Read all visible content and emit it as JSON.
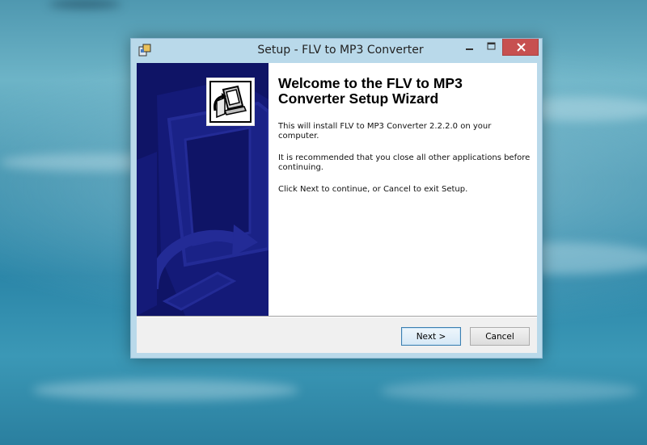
{
  "window": {
    "title": "Setup - FLV to MP3 Converter",
    "caption_buttons": [
      "minimize",
      "maximize",
      "close"
    ]
  },
  "wizard": {
    "heading": "Welcome to the FLV to MP3 Converter Setup Wizard",
    "paragraph_1": "This will install FLV to MP3 Converter 2.2.2.0 on your computer.",
    "paragraph_2": "It is recommended that you close all other applications before continuing.",
    "paragraph_3": "Click Next to continue, or Cancel to exit Setup."
  },
  "buttons": {
    "next": "Next >",
    "cancel": "Cancel"
  },
  "colors": {
    "banner": "#0f1466",
    "close_button": "#c75050",
    "window_frame": "#b9d9ea",
    "default_button_border": "#3c7fb1"
  },
  "icons": {
    "app": "installer-icon",
    "logo": "computer-install-icon",
    "minimize": "minimize-icon",
    "maximize": "maximize-icon",
    "close": "close-icon"
  }
}
